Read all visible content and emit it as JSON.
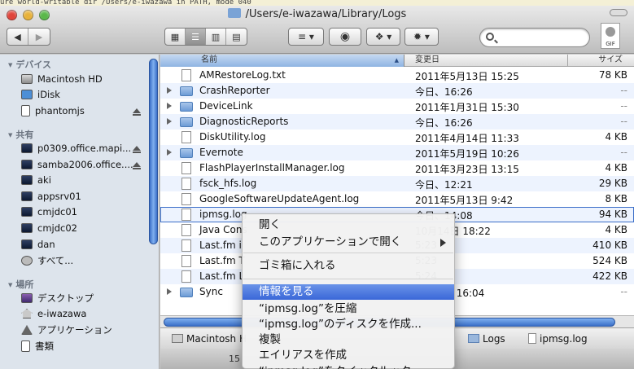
{
  "terminal_bg_text": "ure world-writable dir /Users/e-iwazawa in PATH, mode 040",
  "window": {
    "title": "/Users/e-iwazawa/Library/Logs"
  },
  "toolbar": {
    "back_icon": "chevron-left-icon",
    "forward_icon": "chevron-right-icon",
    "views": [
      "icon-view",
      "list-view",
      "column-view",
      "cover-flow-view"
    ],
    "active_view": "list-view",
    "arrange_icon": "arrange-icon",
    "quicklook_icon": "eye-icon",
    "dropbox_icon": "dropbox-icon",
    "action_icon": "gear-icon",
    "search_placeholder": "",
    "gif_label": "GIF"
  },
  "sidebar": {
    "devices_header": "デバイス",
    "devices": [
      {
        "label": "Macintosh HD",
        "icon": "disk-icon"
      },
      {
        "label": "iDisk",
        "icon": "idisk-icon"
      },
      {
        "label": "phantomjs",
        "icon": "document-icon",
        "eject": true
      }
    ],
    "shared_header": "共有",
    "shared": [
      {
        "label": "p0309.office.mapi...",
        "eject": true
      },
      {
        "label": "samba2006.office....",
        "eject": true
      },
      {
        "label": "aki"
      },
      {
        "label": "appsrv01"
      },
      {
        "label": "cmjdc01"
      },
      {
        "label": "cmjdc02"
      },
      {
        "label": "dan"
      },
      {
        "label": "すべて..."
      }
    ],
    "places_header": "場所",
    "places": [
      {
        "label": "デスクトップ",
        "icon": "desktop-icon"
      },
      {
        "label": "e-iwazawa",
        "icon": "home-icon"
      },
      {
        "label": "アプリケーション",
        "icon": "applications-icon"
      },
      {
        "label": "書類",
        "icon": "documents-icon"
      }
    ]
  },
  "columns": {
    "name": "名前",
    "date": "変更日",
    "size": "サイズ"
  },
  "files": [
    {
      "name": "AMRestoreLog.txt",
      "date": "2011年5月13日 15:25",
      "size": "78 KB",
      "folder": false
    },
    {
      "name": "CrashReporter",
      "date": "今日、16:26",
      "size": "--",
      "folder": true
    },
    {
      "name": "DeviceLink",
      "date": "2011年1月31日 15:30",
      "size": "--",
      "folder": true
    },
    {
      "name": "DiagnosticReports",
      "date": "今日、16:26",
      "size": "--",
      "folder": true
    },
    {
      "name": "DiskUtility.log",
      "date": "2011年4月14日 11:33",
      "size": "4 KB",
      "folder": false
    },
    {
      "name": "Evernote",
      "date": "2011年5月19日 10:26",
      "size": "--",
      "folder": true
    },
    {
      "name": "FlashPlayerInstallManager.log",
      "date": "2011年3月23日 13:15",
      "size": "4 KB",
      "folder": false
    },
    {
      "name": "fsck_hfs.log",
      "date": "今日、12:21",
      "size": "29 KB",
      "folder": false
    },
    {
      "name": "GoogleSoftwareUpdateAgent.log",
      "date": "2011年5月13日 9:42",
      "size": "8 KB",
      "folder": false
    },
    {
      "name": "ipmsg.log",
      "date": "今日、14:08",
      "size": "94 KB",
      "folder": false,
      "selected": true
    },
    {
      "name": "Java Cons",
      "date": "10月14日 18:22",
      "size": "4 KB",
      "folder": false
    },
    {
      "name": "Last.fm i",
      "date": "5:23",
      "size": "410 KB",
      "folder": false
    },
    {
      "name": "Last.fm T",
      "date": "5:23",
      "size": "524 KB",
      "folder": false
    },
    {
      "name": "Last.fm L",
      "date": "5:24",
      "size": "422 KB",
      "folder": false
    },
    {
      "name": "Sync",
      "date": "5月20日 16:04",
      "size": "--",
      "folder": true
    }
  ],
  "pathbar": {
    "items": [
      "Macintosh H",
      "Logs",
      "ipmsg.log"
    ]
  },
  "status": {
    "text": "15"
  },
  "context_menu": {
    "items": [
      {
        "label": "開く"
      },
      {
        "label": "このアプリケーションで開く",
        "submenu": true
      },
      {
        "label": "ゴミ箱に入れる"
      },
      {
        "label": "情報を見る",
        "highlighted": true
      },
      {
        "label": "“ipmsg.log”を圧縮"
      },
      {
        "label": "“ipmsg.log”のディスクを作成..."
      },
      {
        "label": "複製"
      },
      {
        "label": "エイリアスを作成"
      },
      {
        "label": "“ipmsg.log”をクイックルック"
      }
    ]
  }
}
